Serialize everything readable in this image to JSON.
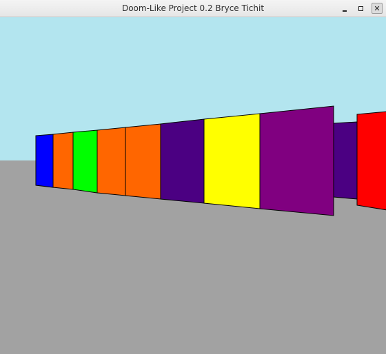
{
  "window": {
    "title": "Doom-Like Project 0.2 Bryce Tichit",
    "controls": {
      "minimize": "minimize-icon",
      "maximize": "maximize-icon",
      "close": "close-icon"
    }
  },
  "scene": {
    "sky_color": "#b3e5ef",
    "floor_color": "#a2a2a2",
    "wall_outline_color": "#000000",
    "wall_panel_colors": [
      "#0000ff",
      "#ff6600",
      "#00ff00",
      "#ff6600",
      "#ff6600",
      "#4b0082",
      "#ffff00",
      "#800080",
      "#4b0082",
      "#ff0000"
    ]
  }
}
